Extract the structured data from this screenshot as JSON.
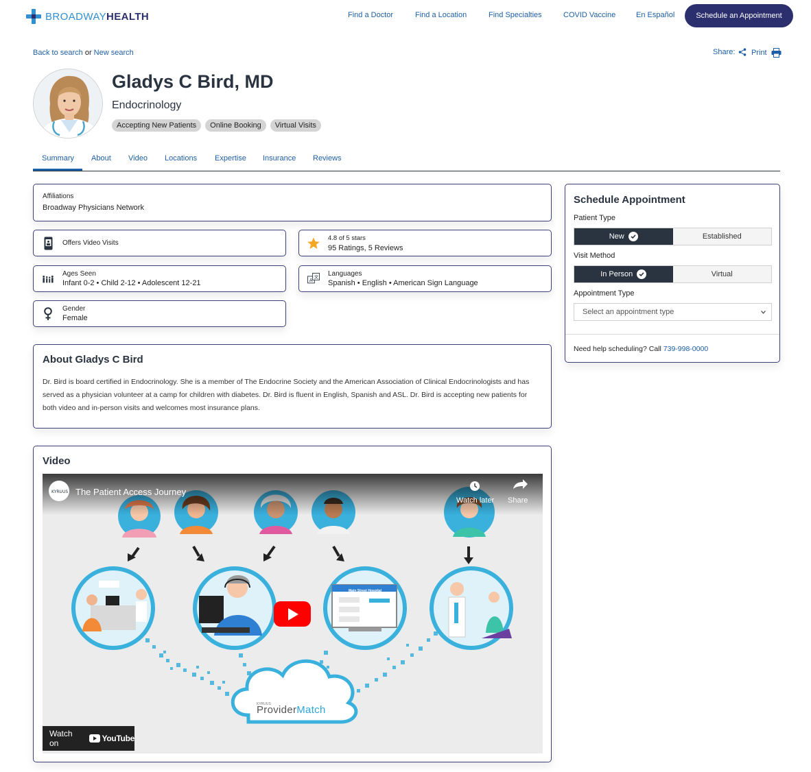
{
  "header": {
    "logo_part1": "BROADWAY",
    "logo_part2": "HEALTH",
    "nav": [
      "Find a Doctor",
      "Find a Location",
      "Find Specialties",
      "COVID Vaccine",
      "En Español"
    ],
    "cta": "Schedule an Appointment"
  },
  "breadcrumb": {
    "back": "Back to search",
    "or": "or",
    "new": "New search"
  },
  "share": {
    "share_label": "Share:",
    "print_label": "Print"
  },
  "profile": {
    "name": "Gladys C Bird, MD",
    "specialty": "Endocrinology",
    "badges": [
      "Accepting New Patients",
      "Online Booking",
      "Virtual Visits"
    ]
  },
  "tabs": [
    "Summary",
    "About",
    "Video",
    "Locations",
    "Expertise",
    "Insurance",
    "Reviews"
  ],
  "affiliations": {
    "label": "Affiliations",
    "value": "Broadway Physicians Network"
  },
  "video_visits": {
    "label": "Offers Video Visits"
  },
  "rating": {
    "stars": "4.8 of 5 stars",
    "link": "95 Ratings, 5 Reviews"
  },
  "ages": {
    "label": "Ages Seen",
    "value": "Infant 0-2 • Child 2-12 • Adolescent 12-21"
  },
  "languages": {
    "label": "Languages",
    "value": "Spanish • English • American Sign Language"
  },
  "gender": {
    "label": "Gender",
    "value": "Female"
  },
  "about": {
    "title": "About Gladys C Bird",
    "text": "Dr. Bird is board certified in Endocrinology. She is a member of The Endocrine Society and the American Association of Clinical Endocrinologists and has served as a physician volunteer at a camp for children with diabetes. Dr. Bird is fluent in English, Spanish and ASL. Dr. Bird is accepting new patients for both video and in-person visits and welcomes most insurance plans."
  },
  "video": {
    "title": "Video",
    "video_title": "The Patient Access Journey",
    "channel": "KYRUUS",
    "watch_later": "Watch later",
    "share": "Share",
    "watch_on": "Watch on",
    "youtube": "YouTube",
    "hospital": "Main Street Hospital",
    "product_small": "KYRUUS",
    "product_1": "Provider",
    "product_2": "Match"
  },
  "schedule": {
    "title": "Schedule Appointment",
    "patient_type_label": "Patient Type",
    "patient_types": [
      "New",
      "Established"
    ],
    "visit_method_label": "Visit Method",
    "visit_methods": [
      "In Person",
      "Virtual"
    ],
    "appointment_type_label": "Appointment Type",
    "appointment_placeholder": "Select an appointment type",
    "help_text": "Need help scheduling? Call",
    "phone": "739-998-0000"
  },
  "colors": {
    "brand_navy": "#2c2f6e",
    "brand_blue": "#2f8fd3",
    "link": "#1d5fa6",
    "star": "#f5a623"
  }
}
